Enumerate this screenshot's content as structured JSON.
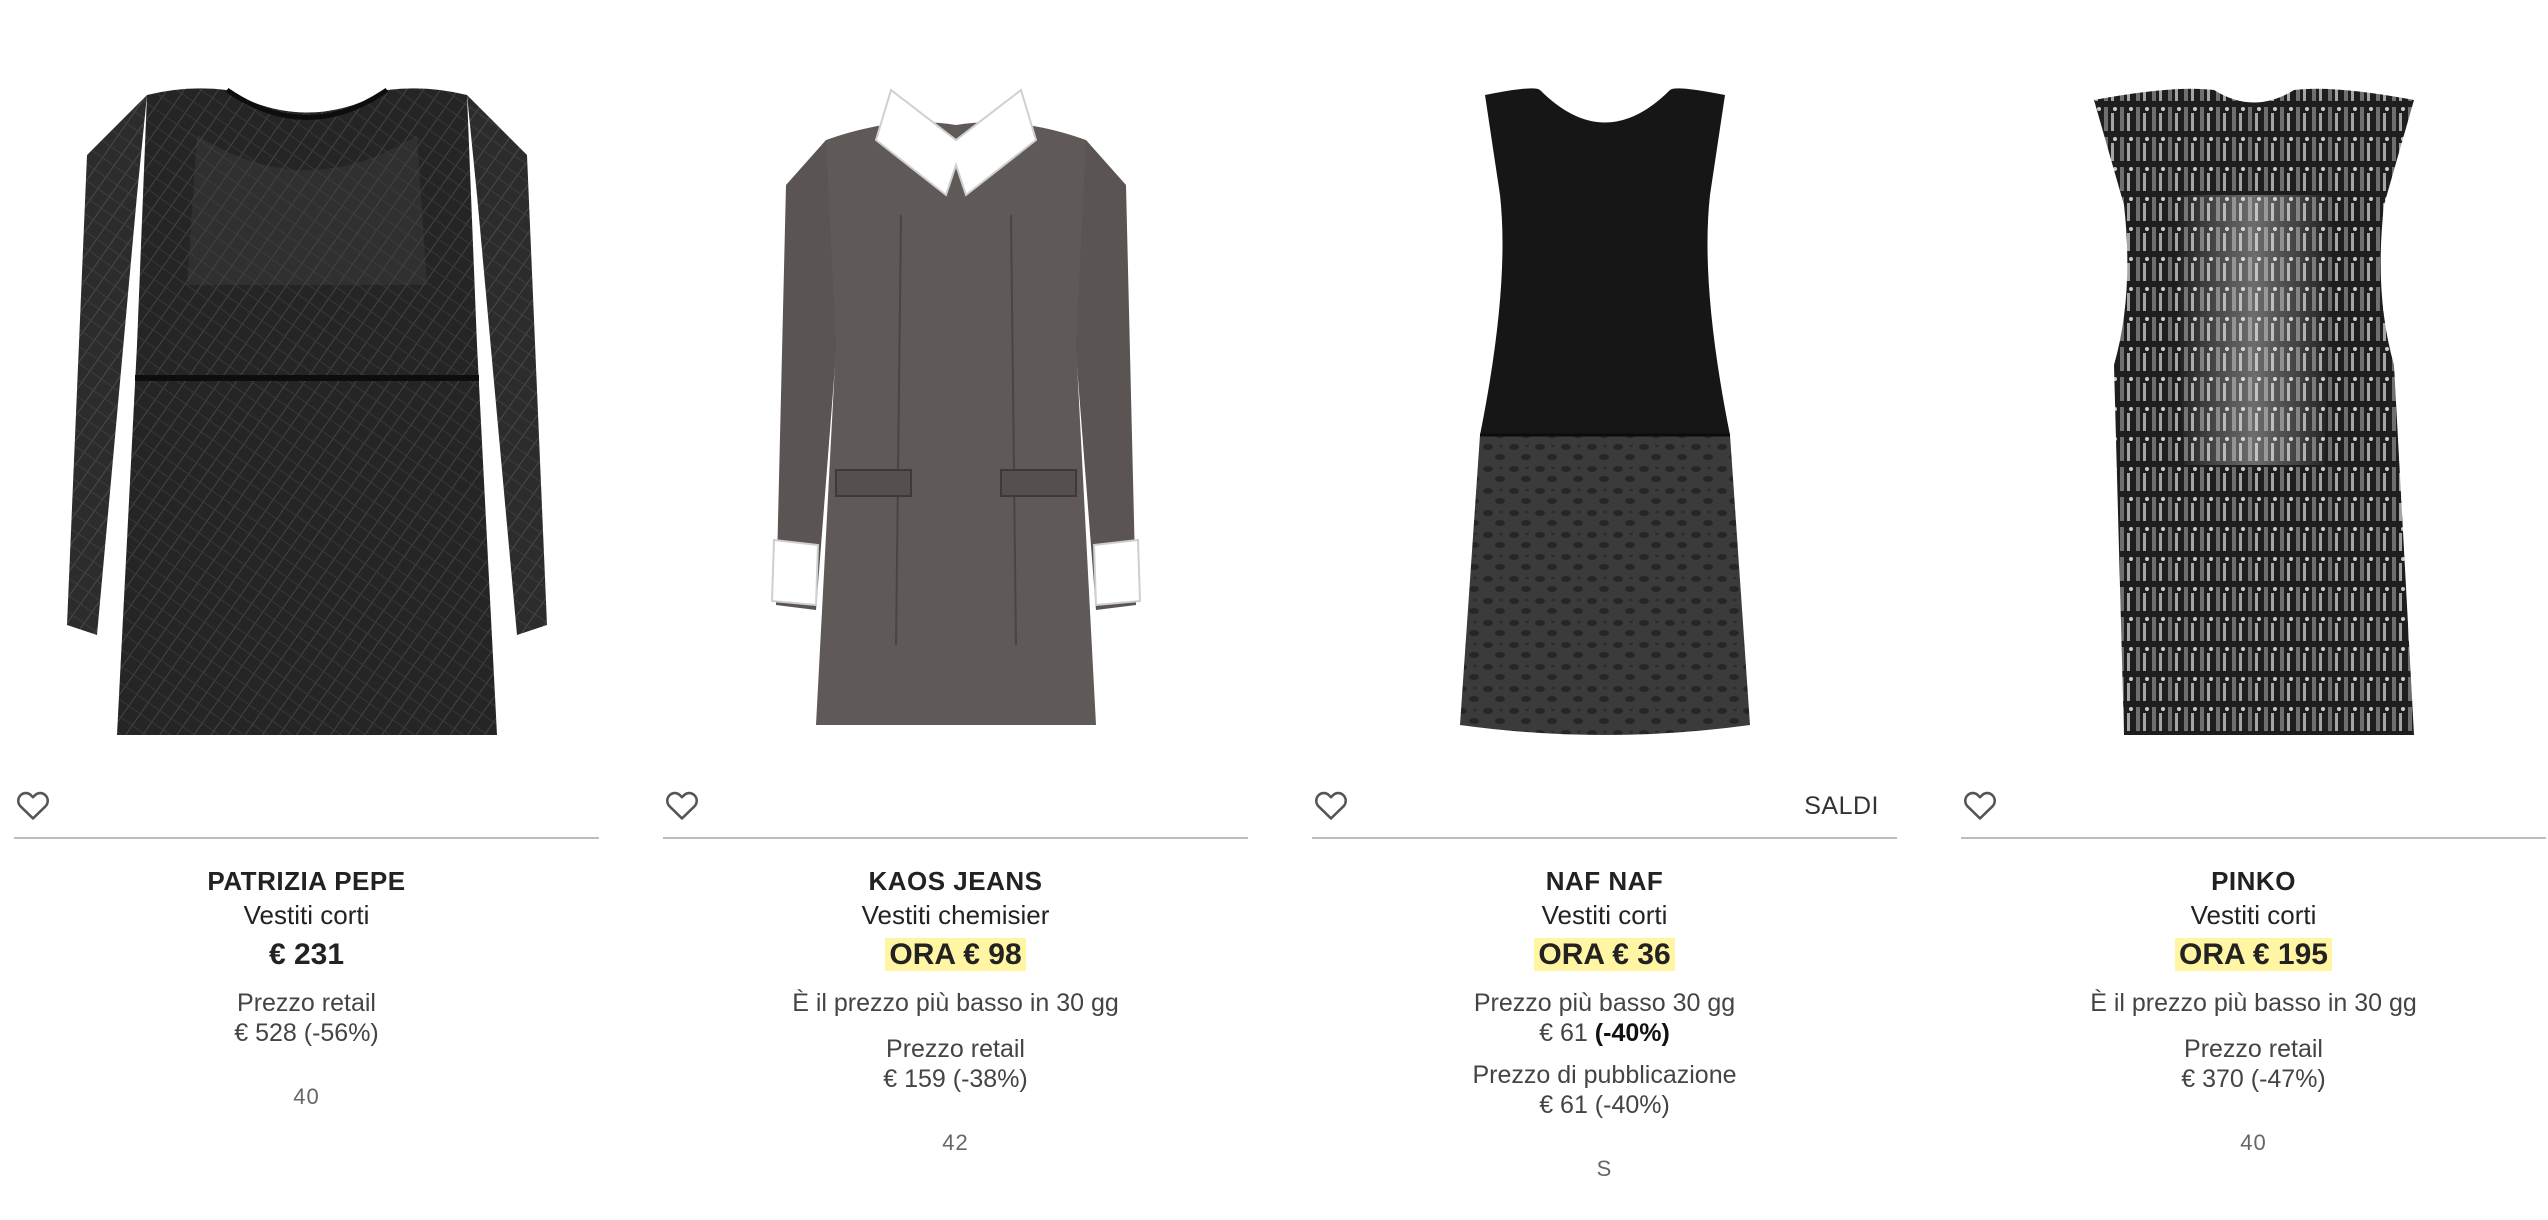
{
  "products": [
    {
      "brand": "PATRIZIA PEPE",
      "category": "Vestiti corti",
      "price": "€ 231",
      "retail_label": "Prezzo retail",
      "retail_value": "€ 528 (-56%)",
      "size": "40"
    },
    {
      "brand": "KAOS JEANS",
      "category": "Vestiti chemisier",
      "price": "ORA € 98",
      "lowest_note": "È il prezzo più basso in 30 gg",
      "retail_label": "Prezzo retail",
      "retail_value": "€ 159 (-38%)",
      "size": "42"
    },
    {
      "brand": "NAF NAF",
      "category": "Vestiti corti",
      "badge": "SALDI",
      "price": "ORA € 36",
      "lowest_label": "Prezzo più basso 30 gg",
      "lowest_value": "€ 61",
      "lowest_discount": "(-40%)",
      "publication_label": "Prezzo di pubblicazione",
      "publication_value": "€ 61 (-40%)",
      "size": "S"
    },
    {
      "brand": "PINKO",
      "category": "Vestiti corti",
      "price": "ORA € 195",
      "lowest_note": "È il prezzo più basso in 30 gg",
      "retail_label": "Prezzo retail",
      "retail_value": "€ 370 (-47%)",
      "size": "40"
    }
  ],
  "icons": {
    "wishlist": "heart-outline-icon"
  },
  "colors": {
    "price_highlight": "#fff5a3",
    "divider": "#bdbdbd",
    "text": "#222222"
  }
}
